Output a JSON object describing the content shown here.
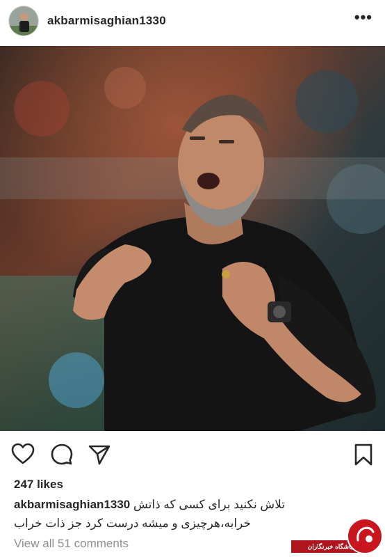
{
  "post": {
    "username": "akbarmisaghian1330",
    "likes": "247 likes",
    "caption_user": "akbarmisaghian1330",
    "caption_line1": "تلاش نکنید برای کسی که ذاتش",
    "caption_line2": "خرابه،هرچیزی و میشه درست کرد جز ذات خراب",
    "view_comments": "View all 51 comments"
  },
  "icons": {
    "more": "more-options-icon",
    "like": "heart-icon",
    "comment": "comment-bubble-icon",
    "share": "share-send-icon",
    "save": "bookmark-icon"
  },
  "watermark": {
    "label": "باشگاه خبرنگاران"
  },
  "colors": {
    "text": "#262626",
    "muted": "#8e8e8e",
    "watermark_red": "#c8151e"
  }
}
